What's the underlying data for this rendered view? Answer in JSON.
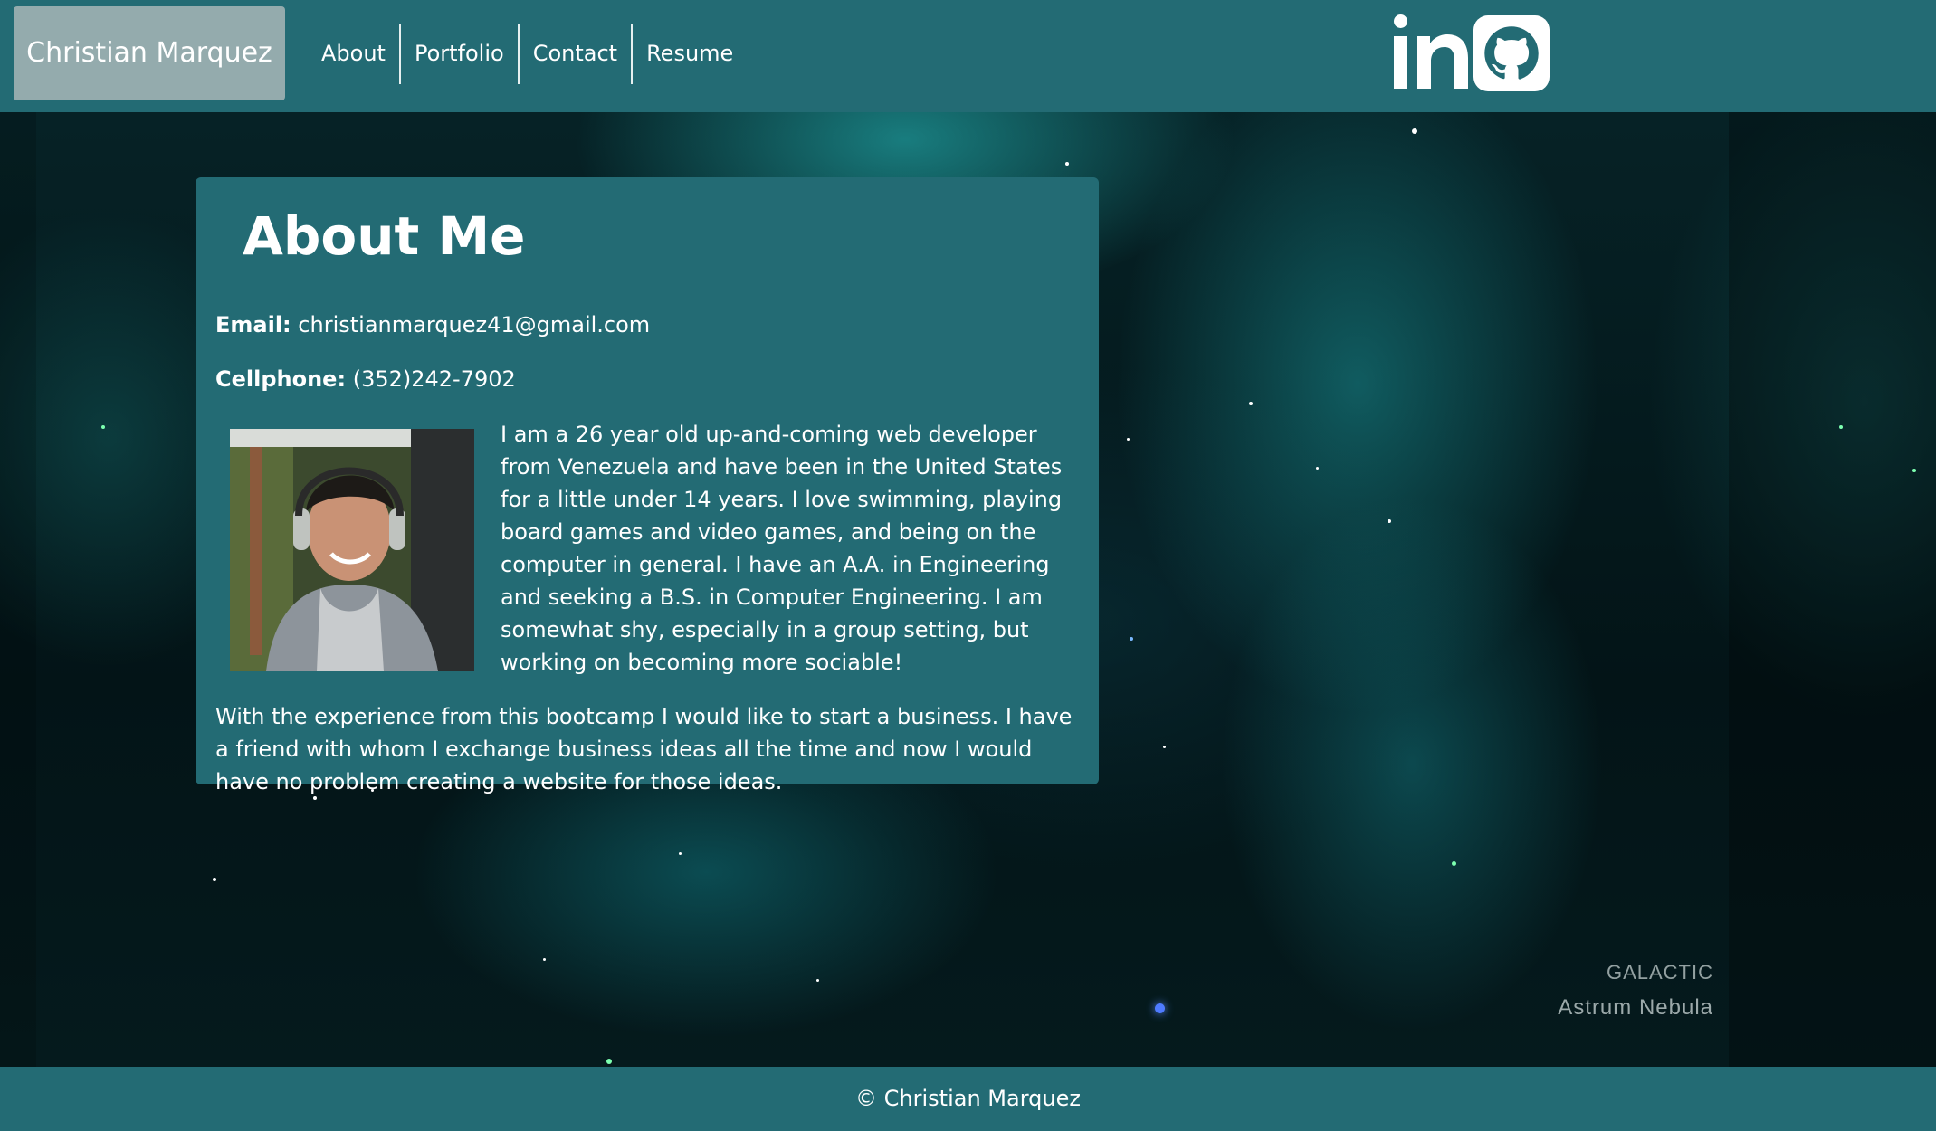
{
  "navbar": {
    "brand": "Christian Marquez",
    "links": [
      {
        "label": "About"
      },
      {
        "label": "Portfolio"
      },
      {
        "label": "Contact"
      },
      {
        "label": "Resume"
      }
    ],
    "social": [
      {
        "icon": "linkedin-icon",
        "label": "in"
      },
      {
        "icon": "github-icon"
      }
    ]
  },
  "about": {
    "title": "About Me",
    "email_label": "Email:",
    "email_value": "christianmarquez41@gmail.com",
    "phone_label": "Cellphone:",
    "phone_value": "(352)242-7902",
    "paragraphs": [
      "I am a 26 year old up-and-coming web developer from Venezuela and have been in the United States for a little under 14 years. I love swimming, playing board games and video games, and being on the computer in general. I have an A.A. in Engineering and seeking a B.S. in Computer Engineering. I am somewhat shy, especially in a group setting, but working on becoming more sociable!",
      "With the experience from this bootcamp I would like to start a business. I have a friend with whom I exchange business ideas all the time and now I would have no problem creating a website for those ideas."
    ]
  },
  "background": {
    "watermark_line1": "GALACTIC",
    "watermark_line2": "Astrum Nebula"
  },
  "footer": {
    "text": "© Christian Marquez"
  },
  "colors": {
    "nav_bg": "#236b74",
    "brand_bg": "#94abad",
    "card_bg": "#236b74",
    "text": "#ffffff"
  }
}
